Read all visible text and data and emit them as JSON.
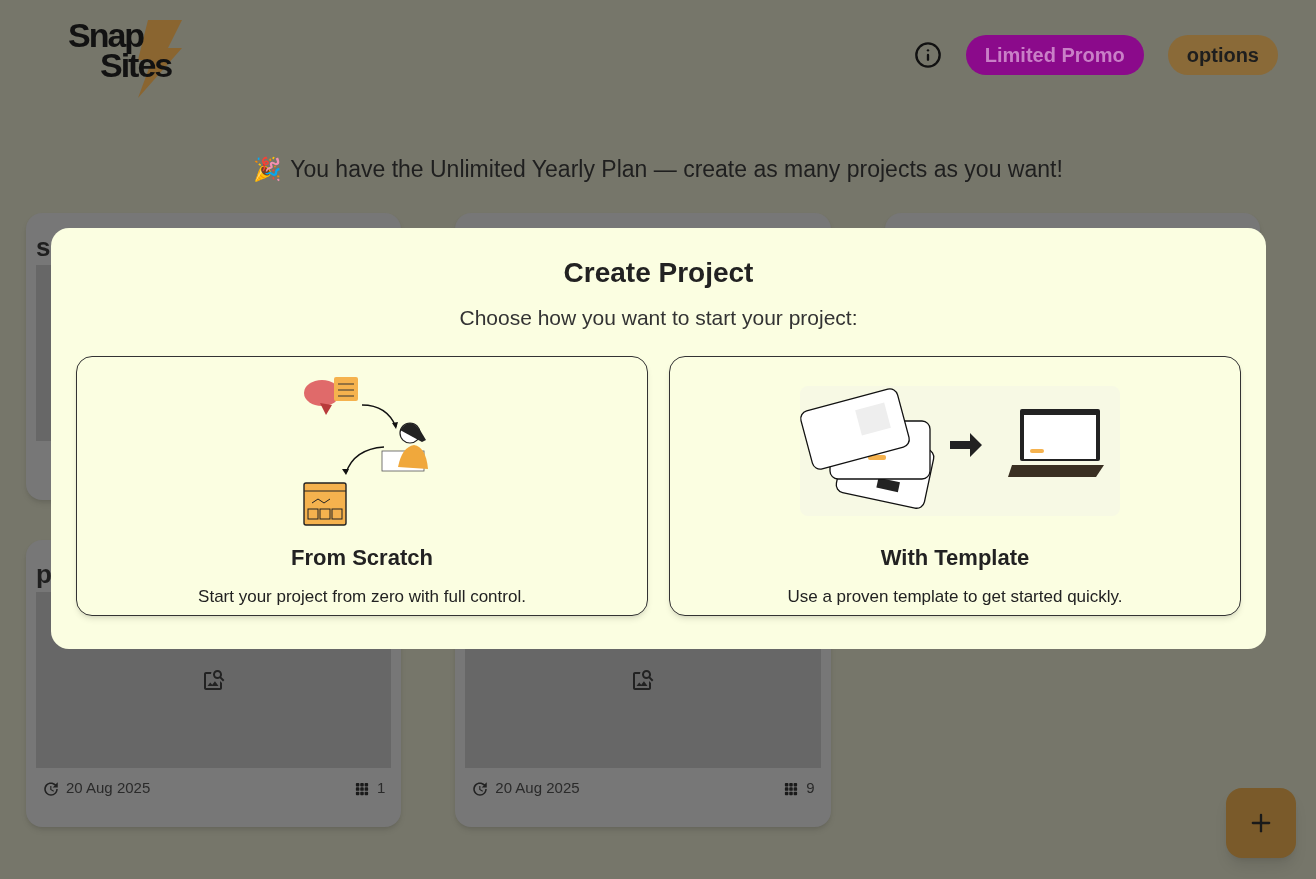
{
  "logo": {
    "lines": [
      "Snap",
      "Sites"
    ]
  },
  "header": {
    "promo_button": "Limited Promo",
    "options_button": "options"
  },
  "banner": {
    "emoji": "🎉",
    "text": "You have the Unlimited Yearly Plan — create as many projects as you want!"
  },
  "projects": [
    {
      "kind": "project",
      "title": "s"
    },
    {
      "kind": "project"
    },
    {
      "kind": "project"
    },
    {
      "kind": "project",
      "title": "p",
      "date": "20 Aug 2025",
      "pages": "1"
    },
    {
      "kind": "project",
      "date": "20 Aug 2025",
      "pages": "9"
    }
  ],
  "modal": {
    "title": "Create Project",
    "subtitle": "Choose how you want to start your project:",
    "options": [
      {
        "kind": "scratch",
        "title": "From Scratch",
        "description": "Start your project from zero with full control."
      },
      {
        "kind": "template",
        "title": "With Template",
        "description": "Use a proven template to get started quickly."
      }
    ]
  }
}
